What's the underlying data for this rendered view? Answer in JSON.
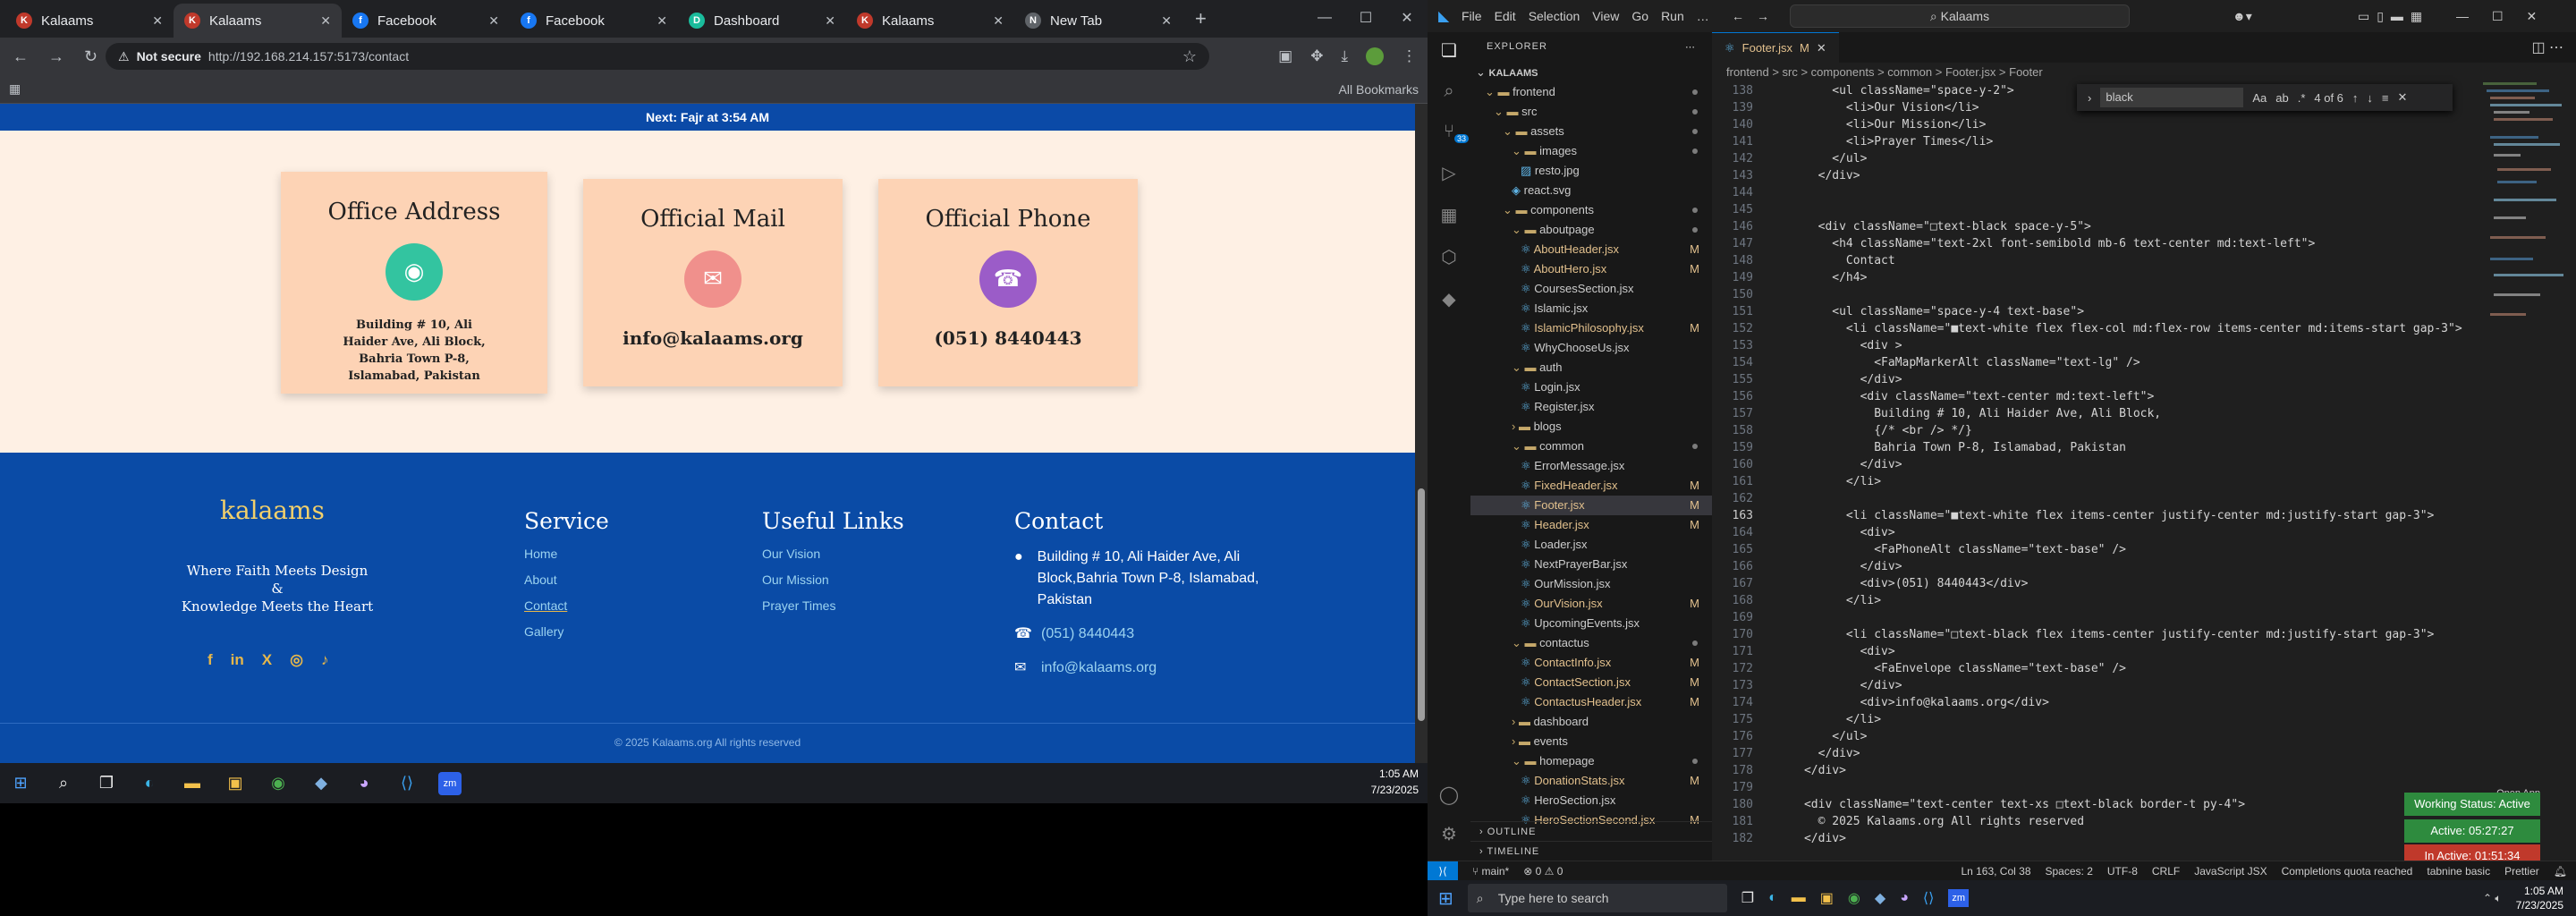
{
  "browser": {
    "tabs": [
      {
        "title": "Kalaams",
        "icon": "K",
        "color": "#c0392b",
        "active": false
      },
      {
        "title": "Kalaams",
        "icon": "K",
        "color": "#c0392b",
        "active": true
      },
      {
        "title": "Facebook",
        "icon": "f",
        "color": "#1877f2",
        "active": false
      },
      {
        "title": "Facebook",
        "icon": "f",
        "color": "#1877f2",
        "active": false
      },
      {
        "title": "Dashboard",
        "icon": "D",
        "color": "#1abc9c",
        "active": false
      },
      {
        "title": "Kalaams",
        "icon": "K",
        "color": "#c0392b",
        "active": false
      },
      {
        "title": "New Tab",
        "icon": "N",
        "color": "#5f6368",
        "active": false
      }
    ],
    "not_secure": "Not secure",
    "url": "http://192.168.214.157:5173/contact",
    "bookmarks": "All Bookmarks"
  },
  "site": {
    "prayer_bar": "Next: Fajr at 3:54 AM",
    "cards": [
      {
        "title": "Office Address",
        "icon_color": "#33c4a0",
        "icon": "◉",
        "text": "Building # 10, Ali Haider Ave, Ali Block, Bahria Town P-8, Islamabad, Pakistan"
      },
      {
        "title": "Official Mail",
        "icon_color": "#f0908c",
        "icon": "✉",
        "text": "info@kalaams.org"
      },
      {
        "title": "Official Phone",
        "icon_color": "#9b5cc8",
        "icon": "☎",
        "text": "(051) 8440443"
      }
    ],
    "footer": {
      "logo": "kalaams",
      "tagline_1": "Where Faith Meets Design",
      "tagline_2": "&",
      "tagline_3": "Knowledge Meets the Heart",
      "service_title": "Service",
      "service": [
        "Home",
        "About",
        "Contact",
        "Gallery"
      ],
      "useful_title": "Useful Links",
      "useful": [
        "Our Vision",
        "Our Mission",
        "Prayer Times"
      ],
      "contact_title": "Contact",
      "address": "Building # 10, Ali Haider Ave, Ali Block,Bahria Town P-8, Islamabad, Pakistan",
      "phone": "(051) 8440443",
      "email": "info@kalaams.org",
      "copyright": "© 2025 Kalaams.org All rights reserved"
    }
  },
  "taskbar": {
    "time": "1:05 AM",
    "date": "7/23/2025"
  },
  "vscode": {
    "menu": [
      "File",
      "Edit",
      "Selection",
      "View",
      "Go",
      "Run",
      "…"
    ],
    "search": "Kalaams",
    "explorer_title": "EXPLORER",
    "tab": "Footer.jsx",
    "tab_badge": "M",
    "breadcrumb": "frontend > src > components > common > Footer.jsx > Footer",
    "find_query": "black",
    "find_count": "4 of 6",
    "tree": [
      {
        "name": "KALAAMS",
        "d": 0,
        "type": "root"
      },
      {
        "name": "frontend",
        "d": 1,
        "type": "folder",
        "dot": true
      },
      {
        "name": "src",
        "d": 2,
        "type": "folder",
        "dot": true
      },
      {
        "name": "assets",
        "d": 3,
        "type": "folder",
        "dot": true
      },
      {
        "name": "images",
        "d": 4,
        "type": "folder",
        "dot": true
      },
      {
        "name": "resto.jpg",
        "d": 5,
        "type": "file"
      },
      {
        "name": "react.svg",
        "d": 4,
        "type": "file"
      },
      {
        "name": "components",
        "d": 3,
        "type": "folder",
        "dot": true
      },
      {
        "name": "aboutpage",
        "d": 4,
        "type": "folder",
        "dot": true
      },
      {
        "name": "AboutHeader.jsx",
        "d": 5,
        "type": "file",
        "m": "M"
      },
      {
        "name": "AboutHero.jsx",
        "d": 5,
        "type": "file",
        "m": "M"
      },
      {
        "name": "CoursesSection.jsx",
        "d": 5,
        "type": "file"
      },
      {
        "name": "Islamic.jsx",
        "d": 5,
        "type": "file"
      },
      {
        "name": "IslamicPhilosophy.jsx",
        "d": 5,
        "type": "file",
        "m": "M"
      },
      {
        "name": "WhyChooseUs.jsx",
        "d": 5,
        "type": "file"
      },
      {
        "name": "auth",
        "d": 4,
        "type": "folder"
      },
      {
        "name": "Login.jsx",
        "d": 5,
        "type": "file"
      },
      {
        "name": "Register.jsx",
        "d": 5,
        "type": "file"
      },
      {
        "name": "blogs",
        "d": 4,
        "type": "folder-closed"
      },
      {
        "name": "common",
        "d": 4,
        "type": "folder",
        "dot": true
      },
      {
        "name": "ErrorMessage.jsx",
        "d": 5,
        "type": "file"
      },
      {
        "name": "FixedHeader.jsx",
        "d": 5,
        "type": "file",
        "m": "M"
      },
      {
        "name": "Footer.jsx",
        "d": 5,
        "type": "file",
        "m": "M",
        "sel": true
      },
      {
        "name": "Header.jsx",
        "d": 5,
        "type": "file",
        "m": "M"
      },
      {
        "name": "Loader.jsx",
        "d": 5,
        "type": "file"
      },
      {
        "name": "NextPrayerBar.jsx",
        "d": 5,
        "type": "file"
      },
      {
        "name": "OurMission.jsx",
        "d": 5,
        "type": "file"
      },
      {
        "name": "OurVision.jsx",
        "d": 5,
        "type": "file",
        "m": "M"
      },
      {
        "name": "UpcomingEvents.jsx",
        "d": 5,
        "type": "file"
      },
      {
        "name": "contactus",
        "d": 4,
        "type": "folder",
        "dot": true
      },
      {
        "name": "ContactInfo.jsx",
        "d": 5,
        "type": "file",
        "m": "M"
      },
      {
        "name": "ContactSection.jsx",
        "d": 5,
        "type": "file",
        "m": "M"
      },
      {
        "name": "ContactusHeader.jsx",
        "d": 5,
        "type": "file",
        "m": "M"
      },
      {
        "name": "dashboard",
        "d": 4,
        "type": "folder-closed"
      },
      {
        "name": "events",
        "d": 4,
        "type": "folder-closed"
      },
      {
        "name": "homepage",
        "d": 4,
        "type": "folder",
        "dot": true
      },
      {
        "name": "DonationStats.jsx",
        "d": 5,
        "type": "file",
        "m": "M"
      },
      {
        "name": "HeroSection.jsx",
        "d": 5,
        "type": "file"
      },
      {
        "name": "HeroSectionSecond.jsx",
        "d": 5,
        "type": "file",
        "m": "M"
      }
    ],
    "outline": "OUTLINE",
    "timeline": "TIMELINE",
    "code": [
      {
        "n": "138",
        "t": "          <ul className=\"space-y-2\">"
      },
      {
        "n": "139",
        "t": "            <li>Our Vision</li>"
      },
      {
        "n": "140",
        "t": "            <li>Our Mission</li>"
      },
      {
        "n": "141",
        "t": "            <li>Prayer Times</li>"
      },
      {
        "n": "142",
        "t": "          </ul>"
      },
      {
        "n": "143",
        "t": "        </div>"
      },
      {
        "n": "144",
        "t": ""
      },
      {
        "n": "145",
        "t": ""
      },
      {
        "n": "146",
        "t": "        <div className=\"□text-black space-y-5\">"
      },
      {
        "n": "147",
        "t": "          <h4 className=\"text-2xl font-semibold mb-6 text-center md:text-left\">"
      },
      {
        "n": "148",
        "t": "            Contact"
      },
      {
        "n": "149",
        "t": "          </h4>"
      },
      {
        "n": "150",
        "t": ""
      },
      {
        "n": "151",
        "t": "          <ul className=\"space-y-4 text-base\">"
      },
      {
        "n": "152",
        "t": "            <li className=\"■text-white flex flex-col md:flex-row items-center md:items-start gap-3\">"
      },
      {
        "n": "153",
        "t": "              <div >"
      },
      {
        "n": "154",
        "t": "                <FaMapMarkerAlt className=\"text-lg\" />"
      },
      {
        "n": "155",
        "t": "              </div>"
      },
      {
        "n": "156",
        "t": "              <div className=\"text-center md:text-left\">"
      },
      {
        "n": "157",
        "t": "                Building # 10, Ali Haider Ave, Ali Block,"
      },
      {
        "n": "158",
        "t": "                {/* <br /> */}"
      },
      {
        "n": "159",
        "t": "                Bahria Town P-8, Islamabad, Pakistan"
      },
      {
        "n": "160",
        "t": "              </div>"
      },
      {
        "n": "161",
        "t": "            </li>"
      },
      {
        "n": "162",
        "t": ""
      },
      {
        "n": "163",
        "t": "            <li className=\"■text-white flex items-center justify-center md:justify-start gap-3\">"
      },
      {
        "n": "164",
        "t": "              <div>"
      },
      {
        "n": "165",
        "t": "                <FaPhoneAlt className=\"text-base\" />"
      },
      {
        "n": "166",
        "t": "              </div>"
      },
      {
        "n": "167",
        "t": "              <div>(051) 8440443</div>"
      },
      {
        "n": "168",
        "t": "            </li>"
      },
      {
        "n": "169",
        "t": ""
      },
      {
        "n": "170",
        "t": "            <li className=\"□text-black flex items-center justify-center md:justify-start gap-3\">"
      },
      {
        "n": "171",
        "t": "              <div>"
      },
      {
        "n": "172",
        "t": "                <FaEnvelope className=\"text-base\" />"
      },
      {
        "n": "173",
        "t": "              </div>"
      },
      {
        "n": "174",
        "t": "              <div>info@kalaams.org</div>"
      },
      {
        "n": "175",
        "t": "            </li>"
      },
      {
        "n": "176",
        "t": "          </ul>"
      },
      {
        "n": "177",
        "t": "        </div>"
      },
      {
        "n": "178",
        "t": "      </div>"
      },
      {
        "n": "179",
        "t": ""
      },
      {
        "n": "180",
        "t": "      <div className=\"text-center text-xs □text-black border-t py-4\">"
      },
      {
        "n": "181",
        "t": "        © 2025 Kalaams.org All rights reserved"
      },
      {
        "n": "182",
        "t": "      </div>"
      }
    ],
    "notifications": [
      {
        "text": "Working Status: Active",
        "color": "#2e8b3e"
      },
      {
        "text": "Active: 05:27:27",
        "color": "#2e8b3e"
      },
      {
        "text": "In Active: 01:51:34",
        "color": "#c0392b"
      }
    ],
    "open_app": "Open App",
    "status": {
      "branch": "main*",
      "problems": "⊗ 0 ⚠ 0",
      "position": "Ln 163, Col 38",
      "spaces": "Spaces: 2",
      "encoding": "UTF-8",
      "eol": "CRLF",
      "language": "JavaScript JSX",
      "tabnine": "Completions quota reached",
      "tabnine2": "tabnine basic",
      "prettier": "Prettier"
    },
    "win_search": "Type here to search",
    "time": "1:05 AM",
    "date": "7/23/2025"
  }
}
